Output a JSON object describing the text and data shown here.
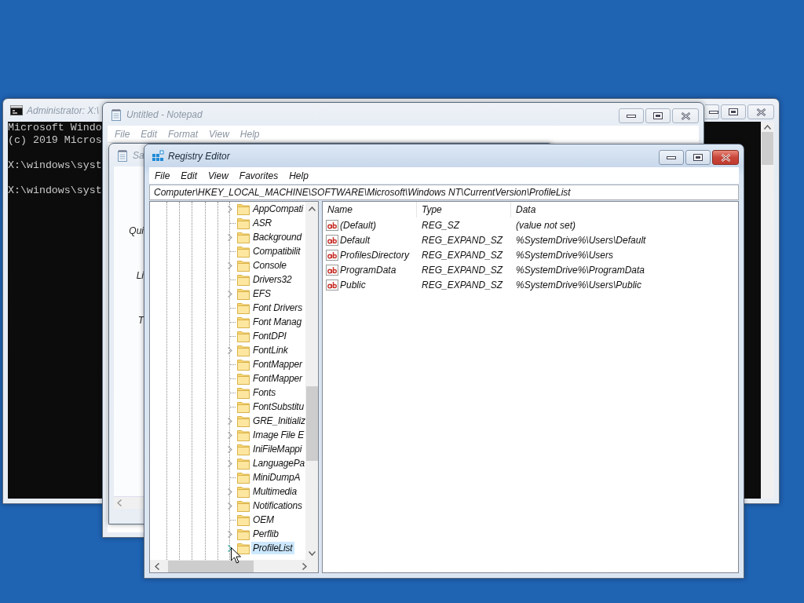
{
  "windows": [
    {
      "kind": "console",
      "title": "Administrator: X:\\",
      "active": false,
      "lines": [
        {
          "kind": "banner",
          "text": "Microsoft Windo"
        },
        {
          "kind": "banner",
          "text": "(c) 2019 Micros"
        },
        {
          "kind": "prompt",
          "text": "X:\\windows\\syst"
        },
        {
          "kind": "prompt",
          "text": "X:\\windows\\syst"
        }
      ]
    },
    {
      "kind": "notepad",
      "title": "Untitled - Notepad",
      "active": false,
      "menu": [
        "File",
        "Edit",
        "Format",
        "View",
        "Help"
      ]
    },
    {
      "kind": "dialog",
      "title": "Sa",
      "active": false,
      "nav": [
        "Qui",
        "Li",
        "T"
      ]
    },
    {
      "kind": "regedit",
      "title": "Registry Editor",
      "active": true,
      "menu": [
        "File",
        "Edit",
        "View",
        "Favorites",
        "Help"
      ],
      "address": "Computer\\HKEY_LOCAL_MACHINE\\SOFTWARE\\Microsoft\\Windows NT\\CurrentVersion\\ProfileList",
      "tree": [
        {
          "label": "AppCompati",
          "expandable": true,
          "selected": false
        },
        {
          "label": "ASR",
          "expandable": false,
          "selected": false
        },
        {
          "label": "Background",
          "expandable": true,
          "selected": false
        },
        {
          "label": "Compatibilit",
          "expandable": false,
          "selected": false
        },
        {
          "label": "Console",
          "expandable": true,
          "selected": false
        },
        {
          "label": "Drivers32",
          "expandable": false,
          "selected": false
        },
        {
          "label": "EFS",
          "expandable": true,
          "selected": false
        },
        {
          "label": "Font Drivers",
          "expandable": false,
          "selected": false
        },
        {
          "label": "Font Manag",
          "expandable": false,
          "selected": false
        },
        {
          "label": "FontDPI",
          "expandable": false,
          "selected": false
        },
        {
          "label": "FontLink",
          "expandable": true,
          "selected": false
        },
        {
          "label": "FontMapper",
          "expandable": false,
          "selected": false
        },
        {
          "label": "FontMapper",
          "expandable": false,
          "selected": false
        },
        {
          "label": "Fonts",
          "expandable": false,
          "selected": false
        },
        {
          "label": "FontSubstitu",
          "expandable": false,
          "selected": false
        },
        {
          "label": "GRE_Initializ",
          "expandable": true,
          "selected": false
        },
        {
          "label": "Image File E",
          "expandable": true,
          "selected": false
        },
        {
          "label": "IniFileMappi",
          "expandable": true,
          "selected": false
        },
        {
          "label": "LanguagePa",
          "expandable": true,
          "selected": false
        },
        {
          "label": "MiniDumpA",
          "expandable": false,
          "selected": false
        },
        {
          "label": "Multimedia",
          "expandable": true,
          "selected": false
        },
        {
          "label": "Notifications",
          "expandable": true,
          "selected": false
        },
        {
          "label": "OEM",
          "expandable": false,
          "selected": false
        },
        {
          "label": "Perflib",
          "expandable": true,
          "selected": false
        },
        {
          "label": "ProfileList",
          "expandable": true,
          "selected": true
        }
      ],
      "columns": [
        "Name",
        "Type",
        "Data"
      ],
      "values": [
        {
          "name": "(Default)",
          "type": "REG_SZ",
          "data": "(value not set)"
        },
        {
          "name": "Default",
          "type": "REG_EXPAND_SZ",
          "data": "%SystemDrive%\\Users\\Default"
        },
        {
          "name": "ProfilesDirectory",
          "type": "REG_EXPAND_SZ",
          "data": "%SystemDrive%\\Users"
        },
        {
          "name": "ProgramData",
          "type": "REG_EXPAND_SZ",
          "data": "%SystemDrive%\\ProgramData"
        },
        {
          "name": "Public",
          "type": "REG_EXPAND_SZ",
          "data": "%SystemDrive%\\Users\\Public"
        }
      ]
    }
  ]
}
